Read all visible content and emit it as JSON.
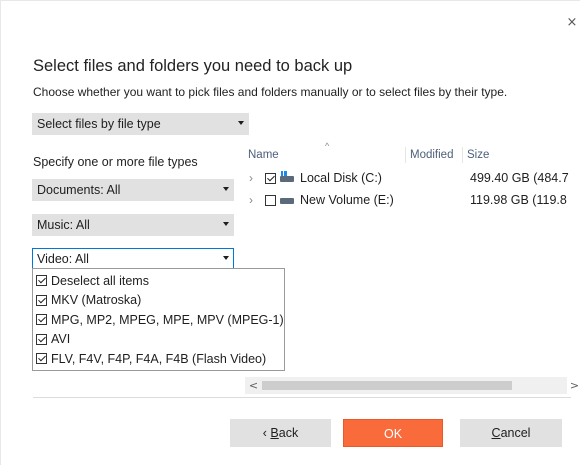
{
  "window": {
    "close_glyph": "×",
    "title": "Select files and folders you need to back up",
    "subtitle": "Choose whether you want to pick files and folders manually or to select files by their type."
  },
  "mode_select": {
    "value": "Select files by file type"
  },
  "file_types": {
    "label": "Specify one or more file types",
    "documents": "Documents: All",
    "music": "Music: All",
    "video": "Video: All",
    "video_options": [
      {
        "label": "Deselect all items",
        "checked": true
      },
      {
        "label": "MKV (Matroska)",
        "checked": true
      },
      {
        "label": "MPG, MP2, MPEG, MPE, MPV (MPEG-1)",
        "checked": true
      },
      {
        "label": "AVI",
        "checked": true
      },
      {
        "label": "FLV, F4V, F4P, F4A, F4B (Flash Video)",
        "checked": true
      }
    ]
  },
  "tree": {
    "columns": {
      "name": "Name",
      "modified": "Modified",
      "size": "Size"
    },
    "rows": [
      {
        "name": "Local Disk (C:)",
        "size": "499.40 GB (484.7",
        "checked": true,
        "icon": "windows-drive-icon"
      },
      {
        "name": "New Volume (E:)",
        "size": "119.98 GB (119.8",
        "checked": false,
        "icon": "drive-icon"
      }
    ]
  },
  "buttons": {
    "back_mnemonic": "B",
    "back_rest": "ack",
    "ok": "OK",
    "cancel_mnemonic": "C",
    "cancel_rest": "ancel"
  },
  "colors": {
    "accent": "#f96b3a",
    "focus": "#0078d7"
  }
}
